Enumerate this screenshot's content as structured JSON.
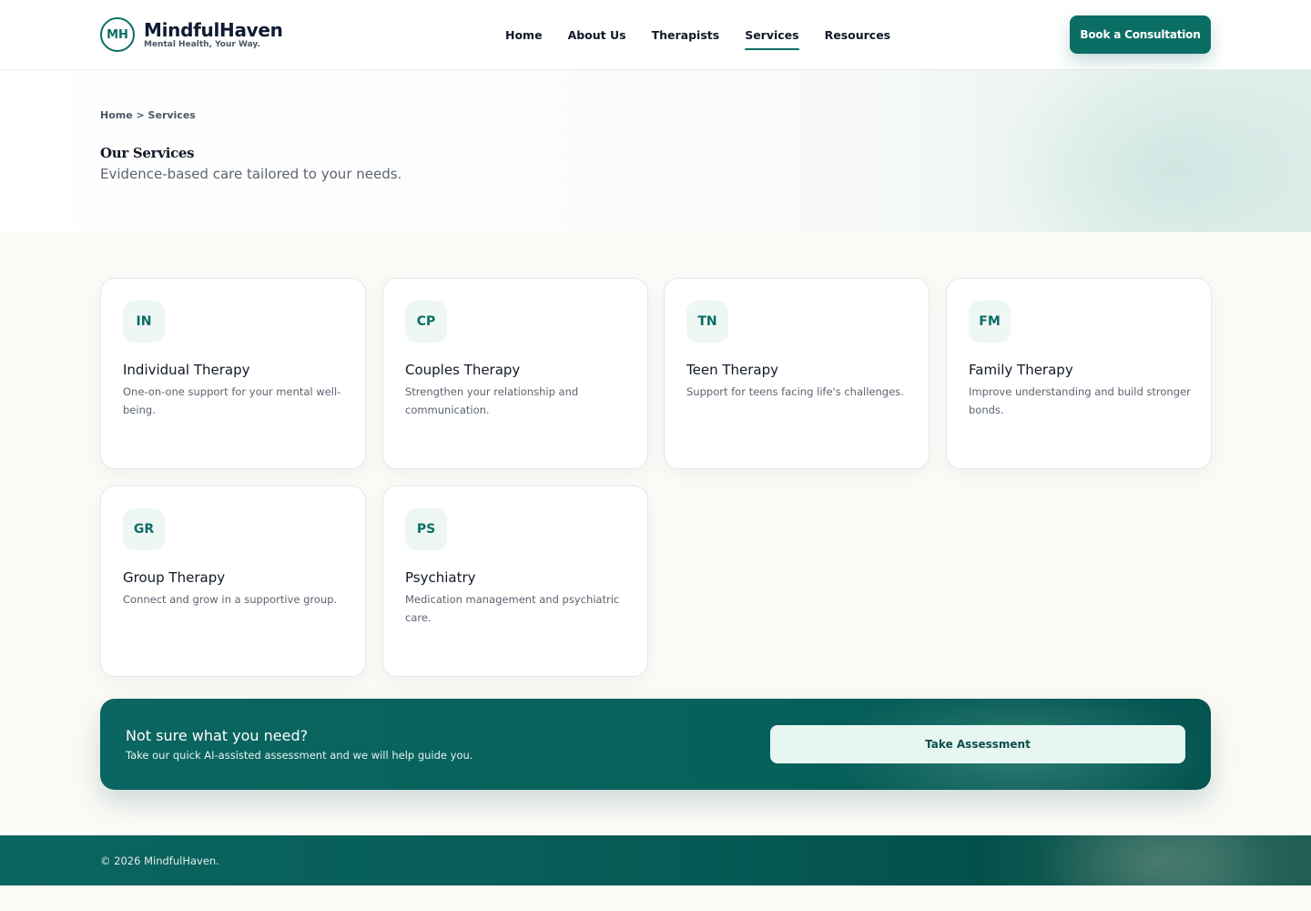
{
  "brand": {
    "badge": "MH",
    "name": "MindfulHaven",
    "tagline": "Mental Health, Your Way."
  },
  "nav": {
    "items": [
      {
        "label": "Home",
        "active": false
      },
      {
        "label": "About Us",
        "active": false
      },
      {
        "label": "Therapists",
        "active": false
      },
      {
        "label": "Services",
        "active": true
      },
      {
        "label": "Resources",
        "active": false
      }
    ],
    "cta_label": "Book a Consultation"
  },
  "hero": {
    "breadcrumb": "Home > Services",
    "title": "Our Services",
    "subtitle": "Evidence-based care tailored to your needs."
  },
  "services": [
    {
      "icon": "IN",
      "title": "Individual Therapy",
      "desc": "One-on-one support for your mental well-being."
    },
    {
      "icon": "CP",
      "title": "Couples Therapy",
      "desc": "Strengthen your relationship and communication."
    },
    {
      "icon": "TN",
      "title": "Teen Therapy",
      "desc": "Support for teens facing life's challenges."
    },
    {
      "icon": "FM",
      "title": "Family Therapy",
      "desc": "Improve understanding and build stronger bonds."
    },
    {
      "icon": "GR",
      "title": "Group Therapy",
      "desc": "Connect and grow in a supportive group."
    },
    {
      "icon": "PS",
      "title": "Psychiatry",
      "desc": "Medication management and psychiatric care."
    }
  ],
  "assessment": {
    "title": "Not sure what you need?",
    "subtitle": "Take our quick AI-assisted assessment and we will help guide you.",
    "button_label": "Take Assessment"
  },
  "footer": {
    "copyright": "© 2026 MindfulHaven."
  },
  "colors": {
    "primary": "#0b6e64",
    "dark_teal": "#045450",
    "icon_bg": "#eef7f4",
    "page_bg": "#fbfaf7"
  }
}
